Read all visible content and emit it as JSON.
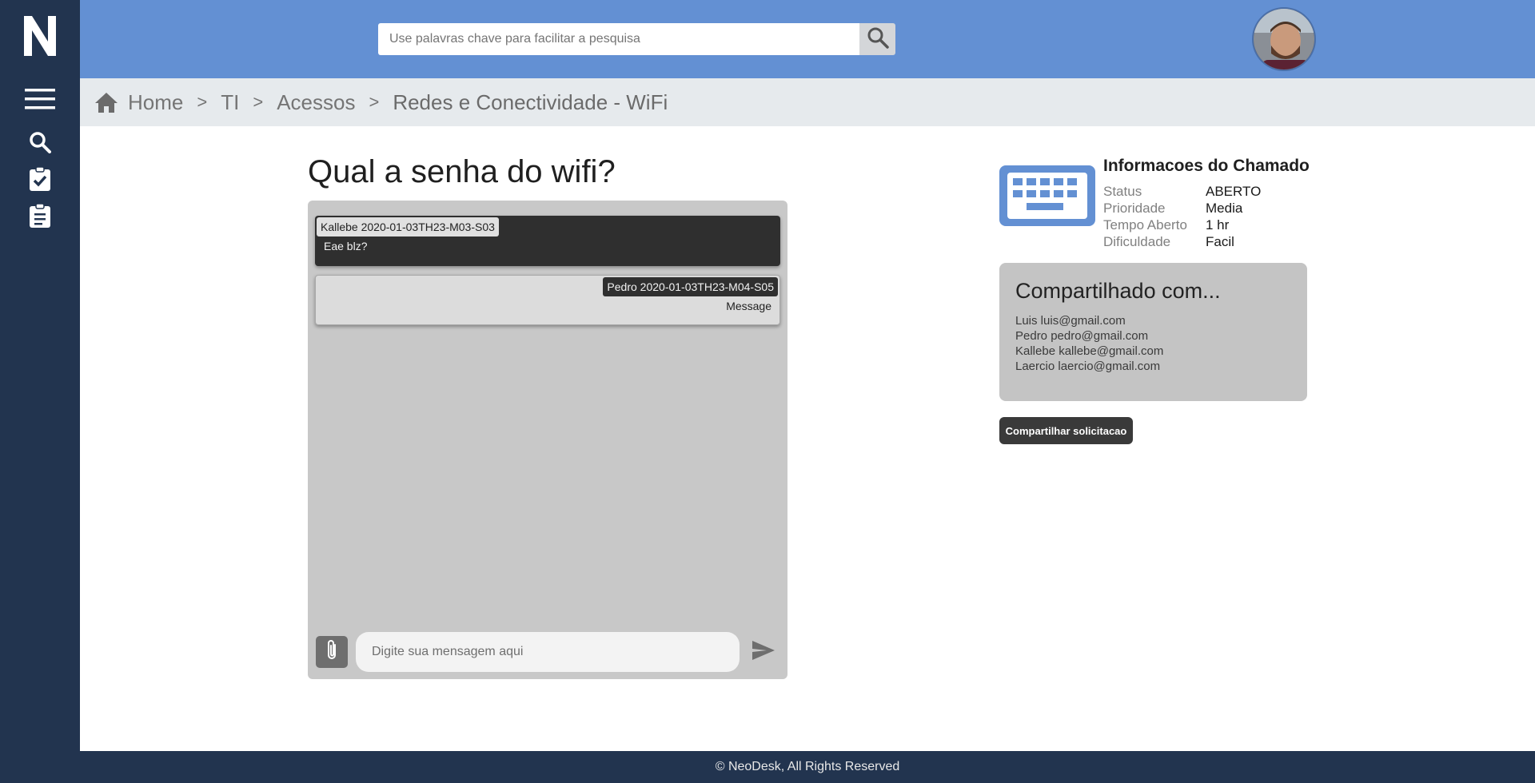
{
  "app": {
    "logo_letter": "N",
    "brand_color": "#6390d3",
    "sidebar_color": "#22344f"
  },
  "sidebar": {
    "items": [
      {
        "name": "menu",
        "icon": "hamburger-icon"
      },
      {
        "name": "search",
        "icon": "search-icon"
      },
      {
        "name": "tasks",
        "icon": "clipboard-check-icon"
      },
      {
        "name": "requests",
        "icon": "clipboard-list-icon"
      }
    ]
  },
  "header": {
    "search_placeholder": "Use palavras chave para facilitar a pesquisa",
    "search_icon": "search-icon",
    "avatar": "user-avatar"
  },
  "breadcrumb": {
    "home_icon": "home-icon",
    "items": [
      "Home",
      "TI",
      "Acessos",
      "Redes e Conectividade - WiFi"
    ],
    "separator": ">"
  },
  "ticket": {
    "title": "Qual a senha do wifi?"
  },
  "chat": {
    "messages": [
      {
        "author_stamp": "Kallebe 2020-01-03TH23-M03-S03",
        "text": "Eae blz?",
        "side": "left"
      },
      {
        "author_stamp": "Pedro 2020-01-03TH23-M04-S05",
        "text": "Message",
        "side": "right"
      }
    ],
    "input_placeholder": "Digite sua mensagem aqui",
    "attach_icon": "paperclip-icon",
    "send_icon": "send-icon"
  },
  "info": {
    "icon": "keyboard-icon",
    "title": "Informacoes do Chamado",
    "rows": [
      {
        "key": "Status",
        "value": "ABERTO"
      },
      {
        "key": "Prioridade",
        "value": "Media"
      },
      {
        "key": "Tempo Aberto",
        "value": "1 hr"
      },
      {
        "key": "Dificuldade",
        "value": "Facil"
      }
    ]
  },
  "shared": {
    "title": "Compartilhado com...",
    "people": [
      "Luis luis@gmail.com",
      "Pedro pedro@gmail.com",
      "Kallebe kallebe@gmail.com",
      "Laercio laercio@gmail.com"
    ]
  },
  "share_button": {
    "label": "Compartilhar solicitacao"
  },
  "footer": {
    "text": "© NeoDesk, All Rights Reserved"
  }
}
